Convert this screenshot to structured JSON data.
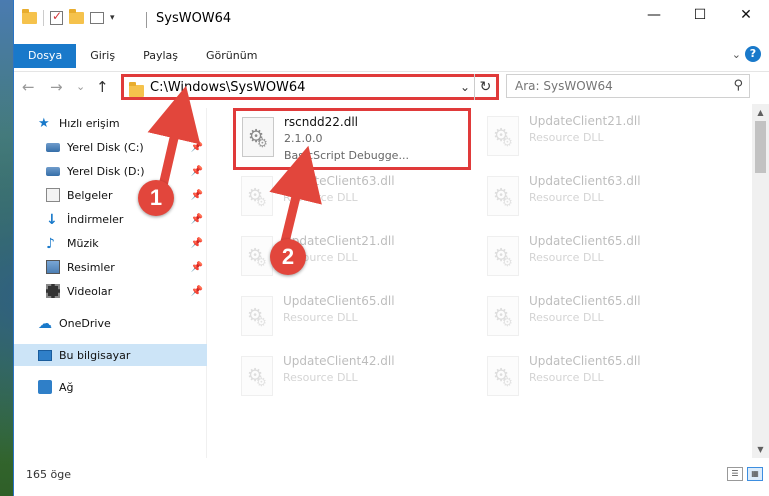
{
  "window": {
    "title": "SysWOW64",
    "controls": {
      "minimize": "—",
      "maximize": "☐",
      "close": "✕"
    }
  },
  "ribbon": {
    "tabs": [
      "Dosya",
      "Giriş",
      "Paylaş",
      "Görünüm"
    ],
    "active_tab": "Dosya",
    "expand": "⌄",
    "help": "?"
  },
  "nav": {
    "back": "←",
    "forward": "→",
    "recent": "⌄",
    "up": "↑"
  },
  "address": {
    "path": "C:\\Windows\\SysWOW64",
    "dropdown": "⌄",
    "refresh": "↻"
  },
  "search": {
    "placeholder": "Ara: SysWOW64",
    "icon": "⚲"
  },
  "sidebar": {
    "items": [
      {
        "label": "Hızlı erişim",
        "icon": "star-icon",
        "pinned": false
      },
      {
        "label": "Yerel Disk (C:)",
        "icon": "drive-icon",
        "pinned": true
      },
      {
        "label": "Yerel Disk (D:)",
        "icon": "drive-icon",
        "pinned": true
      },
      {
        "label": "Belgeler",
        "icon": "documents-icon",
        "pinned": true
      },
      {
        "label": "İndirmeler",
        "icon": "download-icon",
        "pinned": true
      },
      {
        "label": "Müzik",
        "icon": "music-icon",
        "pinned": true
      },
      {
        "label": "Resimler",
        "icon": "pictures-icon",
        "pinned": true
      },
      {
        "label": "Videolar",
        "icon": "video-icon",
        "pinned": true
      },
      {
        "label": "OneDrive",
        "icon": "cloud-icon",
        "pinned": false
      },
      {
        "label": "Bu bilgisayar",
        "icon": "computer-icon",
        "pinned": false
      },
      {
        "label": "Ağ",
        "icon": "network-icon",
        "pinned": false
      }
    ],
    "pin_glyph": "📌"
  },
  "files": {
    "highlighted": {
      "name": "rscndd22.dll",
      "version": "2.1.0.0",
      "description": "BasicScript Debugge..."
    },
    "left_column": [
      {
        "name": "UpdateClient63.dll",
        "description": "Resource DLL"
      },
      {
        "name": "UpdateClient21.dll",
        "description": "Resource DLL"
      },
      {
        "name": "UpdateClient65.dll",
        "description": "Resource DLL"
      },
      {
        "name": "UpdateClient42.dll",
        "description": "Resource DLL"
      }
    ],
    "right_column": [
      {
        "name": "UpdateClient21.dll",
        "description": "Resource DLL"
      },
      {
        "name": "UpdateClient63.dll",
        "description": "Resource DLL"
      },
      {
        "name": "UpdateClient65.dll",
        "description": "Resource DLL"
      },
      {
        "name": "UpdateClient65.dll",
        "description": "Resource DLL"
      },
      {
        "name": "UpdateClient65.dll",
        "description": "Resource DLL"
      }
    ]
  },
  "status": {
    "count": "165 öge"
  },
  "markers": [
    "1",
    "2"
  ],
  "colors": {
    "accent": "#1979ca",
    "highlight": "#e03a3a"
  }
}
